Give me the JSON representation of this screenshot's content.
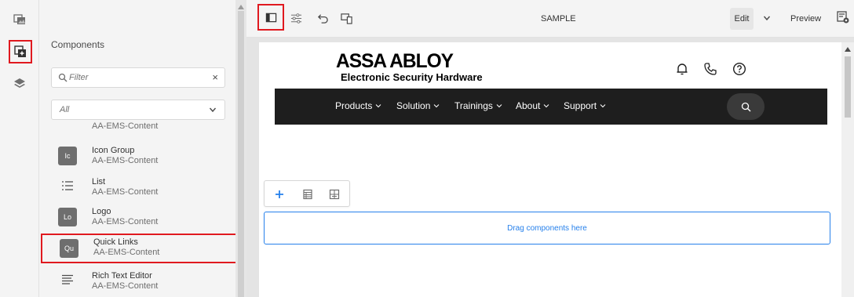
{
  "rail": {
    "items": [
      {
        "name": "assets-icon"
      },
      {
        "name": "components-icon",
        "active": true
      },
      {
        "name": "content-tree-icon"
      }
    ]
  },
  "panel": {
    "title": "Components",
    "filter": {
      "placeholder": "Filter",
      "clear": "×"
    },
    "group_select": {
      "value": "All"
    },
    "items": [
      {
        "name": "",
        "group": "AA-EMS-Content",
        "partial": true
      },
      {
        "name": "Icon Group",
        "group": "AA-EMS-Content",
        "badge": "Ic"
      },
      {
        "name": "List",
        "group": "AA-EMS-Content",
        "icon": "list-icon"
      },
      {
        "name": "Logo",
        "group": "AA-EMS-Content",
        "badge": "Lo"
      },
      {
        "name": "Quick Links",
        "group": "AA-EMS-Content",
        "badge": "Qu",
        "highlighted": true
      },
      {
        "name": "Rich Text Editor",
        "group": "AA-EMS-Content",
        "icon": "text-align-icon"
      }
    ]
  },
  "topbar": {
    "page_name": "SAMPLE",
    "mode": "Edit",
    "preview": "Preview"
  },
  "site": {
    "brand": "ASSA ABLOY",
    "tagline": "Electronic Security Hardware",
    "nav": [
      "Products",
      "Solution",
      "Trainings",
      "About",
      "Support"
    ]
  },
  "dropzone": {
    "label": "Drag components here"
  },
  "colors": {
    "highlight": "#e0191f",
    "accent": "#2680eb",
    "nav_bg": "#1e1e1e",
    "panel_bg": "#f4f4f4"
  }
}
